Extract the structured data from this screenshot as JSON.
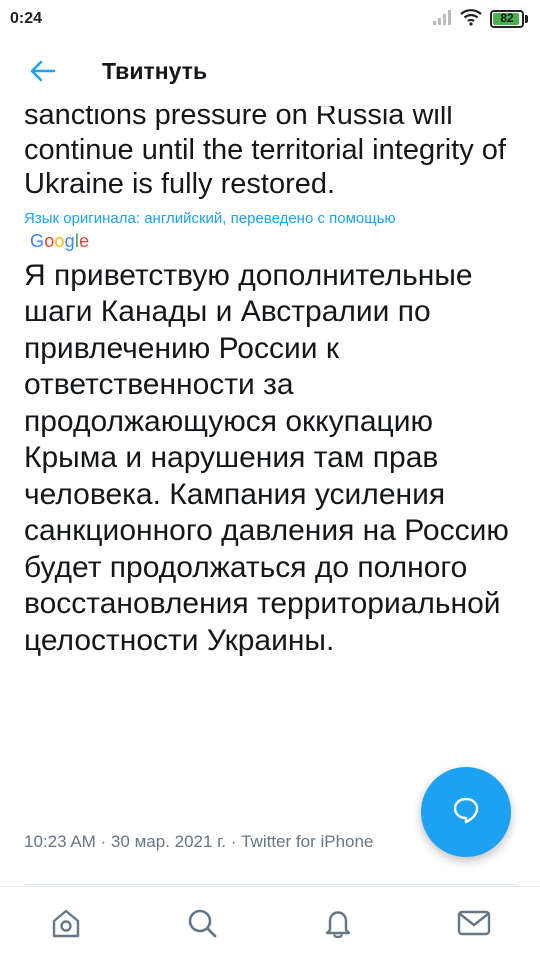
{
  "status_bar": {
    "time": "0:24",
    "battery_level": "82",
    "icons": [
      "signal-icon",
      "wifi-icon",
      "battery-icon"
    ]
  },
  "header": {
    "back_icon": "arrow-left-icon",
    "title": "Твитнуть"
  },
  "tweet": {
    "original_text": "sanctions pressure on Russia will continue until the territorial integrity of Ukraine is fully restored.",
    "translation_note": "Язык оригинала: английский, переведено с помощью",
    "translation_provider": "Google",
    "translated_text": "Я приветствую дополнительные шаги Канады и Австралии по привлечению России к ответственности за продолжающуюся оккупацию Крыма и нарушения там прав человека. Кампания усиления санкционного давления на Россию будет продолжаться до полного восстановления территориальной целостности Украины.",
    "timestamp": "10:23 AM · 30 мар. 2021 г. · Twitter for iPhone"
  },
  "fab": {
    "icon": "reply-bubble-icon"
  },
  "bottom_nav": {
    "items": [
      "home-icon",
      "search-icon",
      "notifications-icon",
      "messages-icon"
    ]
  },
  "colors": {
    "accent": "#1da1f2",
    "text": "#14171a",
    "secondary": "#657786"
  }
}
